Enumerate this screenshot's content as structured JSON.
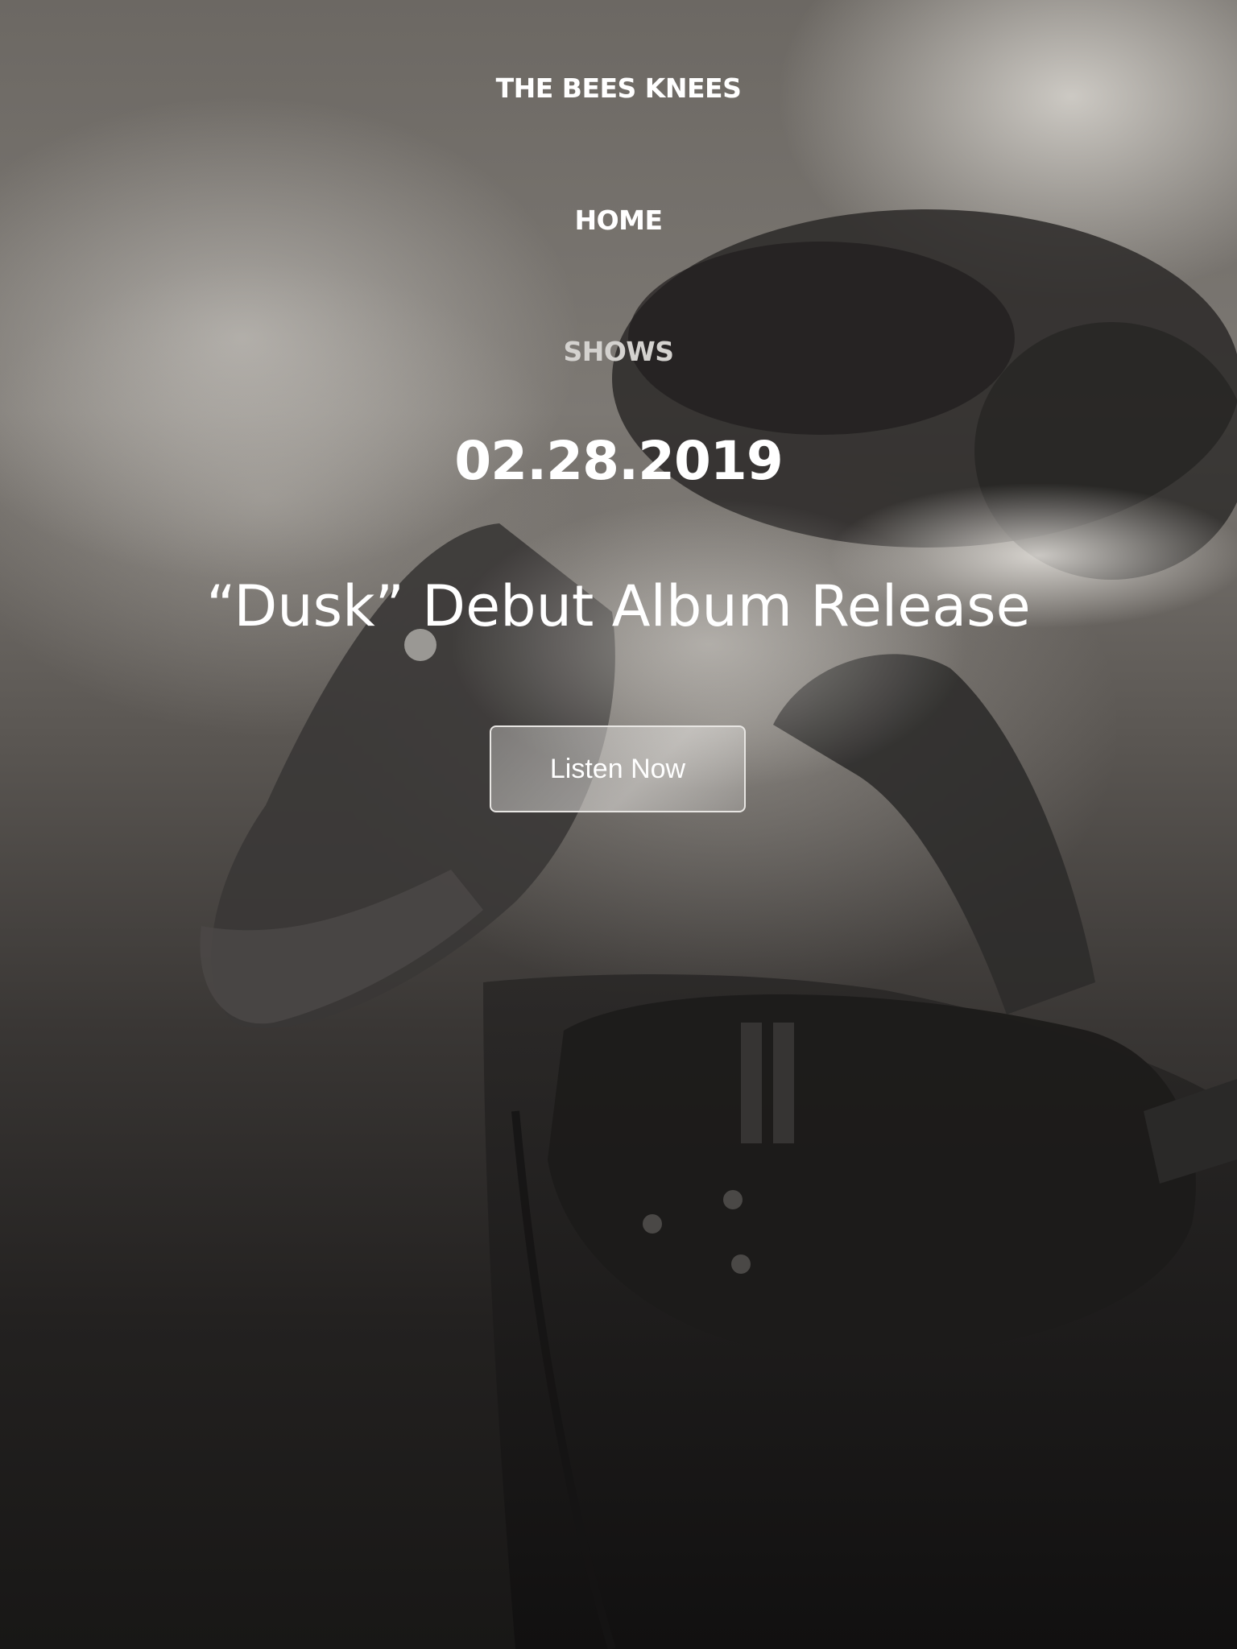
{
  "header": {
    "brand": "THE BEES KNEES"
  },
  "nav": {
    "items": [
      {
        "label": "HOME"
      },
      {
        "label": "SHOWS"
      }
    ]
  },
  "hero": {
    "date": "02.28.2019",
    "title": "“Dusk” Debut Album Release",
    "cta_label": "Listen Now",
    "image": "monochrome-concert-guitarist-photo"
  },
  "colors": {
    "text_primary": "#ffffff",
    "nav_inactive": "#d4d2cf",
    "button_border": "#e8e6e3"
  }
}
